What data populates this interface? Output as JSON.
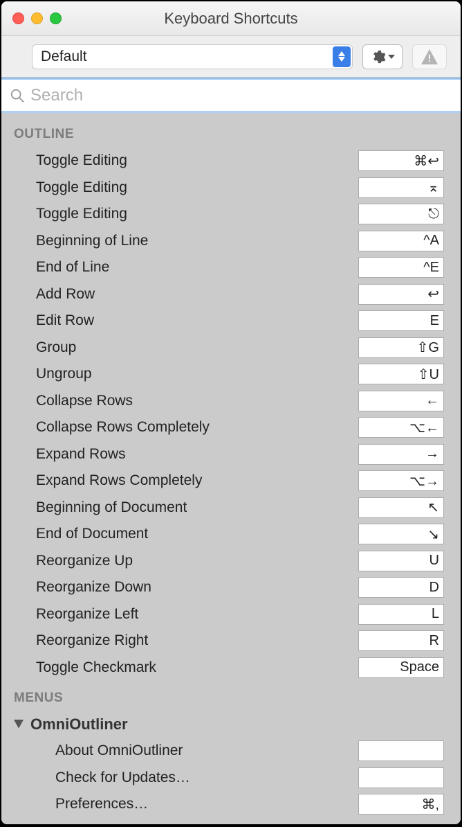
{
  "window": {
    "title": "Keyboard Shortcuts"
  },
  "toolbar": {
    "preset": "Default"
  },
  "search": {
    "placeholder": "Search"
  },
  "sections": {
    "outline": {
      "header": "OUTLINE",
      "items": [
        {
          "label": "Toggle Editing",
          "shortcut": "⌘↩"
        },
        {
          "label": "Toggle Editing",
          "shortcut": "⌅"
        },
        {
          "label": "Toggle Editing",
          "shortcut": "⎋"
        },
        {
          "label": "Beginning of Line",
          "shortcut": "^A"
        },
        {
          "label": "End of Line",
          "shortcut": "^E"
        },
        {
          "label": "Add Row",
          "shortcut": "↩"
        },
        {
          "label": "Edit Row",
          "shortcut": "E"
        },
        {
          "label": "Group",
          "shortcut": "⇧G"
        },
        {
          "label": "Ungroup",
          "shortcut": "⇧U"
        },
        {
          "label": "Collapse Rows",
          "shortcut": "←"
        },
        {
          "label": "Collapse Rows Completely",
          "shortcut": "⌥←"
        },
        {
          "label": "Expand Rows",
          "shortcut": "→"
        },
        {
          "label": "Expand Rows Completely",
          "shortcut": "⌥→"
        },
        {
          "label": "Beginning of Document",
          "shortcut": "↖"
        },
        {
          "label": "End of Document",
          "shortcut": "↘"
        },
        {
          "label": "Reorganize Up",
          "shortcut": "U"
        },
        {
          "label": "Reorganize Down",
          "shortcut": "D"
        },
        {
          "label": "Reorganize Left",
          "shortcut": "L"
        },
        {
          "label": "Reorganize Right",
          "shortcut": "R"
        },
        {
          "label": "Toggle Checkmark",
          "shortcut": "Space"
        }
      ]
    },
    "menus": {
      "header": "MENUS",
      "group": "OmniOutliner",
      "items": [
        {
          "label": "About OmniOutliner",
          "shortcut": ""
        },
        {
          "label": "Check for Updates…",
          "shortcut": ""
        },
        {
          "label": "Preferences…",
          "shortcut": "⌘,"
        }
      ]
    }
  }
}
